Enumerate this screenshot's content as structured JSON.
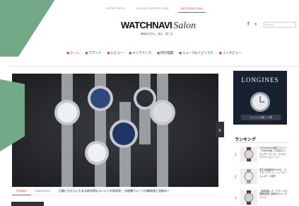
{
  "topnav": [
    {
      "label": "CARTIER WATCH"
    },
    {
      "label": "LUXURY CONTENTS GUIDE"
    },
    {
      "label": "WATCHNAVI Salon",
      "active": true
    }
  ],
  "header": {
    "logo_main": "WATCHNAVI",
    "logo_sub": "Salon",
    "tagline": "腕時計を学ぶ、愉む、愛でる",
    "search_placeholder": "Search"
  },
  "mainnav": [
    {
      "label": "ホーム",
      "active": true
    },
    {
      "label": "ブランド"
    },
    {
      "label": "レビュー"
    },
    {
      "label": "メンテナンス"
    },
    {
      "label": "時計図鑑"
    },
    {
      "label": "ニュース&トピックス"
    },
    {
      "label": "インタビュー"
    }
  ],
  "hero": {
    "caption_tabs": [
      {
        "label": "Feature",
        "active": true
      },
      {
        "label": "sponsored"
      }
    ],
    "caption": "正確にも大人にもある新作時計コンシンを再発見！ 伝統腕ウォーツの最新源と見極め―"
  },
  "ad": {
    "brand": "LONGINES",
    "sub": "ロンジンの新しい物"
  },
  "ranking": {
    "title": "ランキング",
    "items": [
      {
        "num": "1",
        "text": "CARAVANの高級ブランド「HARRA産」の名作ロングレザーストラップレザーエディションニュー"
      },
      {
        "num": "2",
        "text": "新生高級腕時計OLYS、ストラップワラ、シンフォームレポート新作"
      },
      {
        "num": "3",
        "text": "【最新版】オーバホールの価格相場と腕時計のメンテナンス"
      }
    ]
  }
}
